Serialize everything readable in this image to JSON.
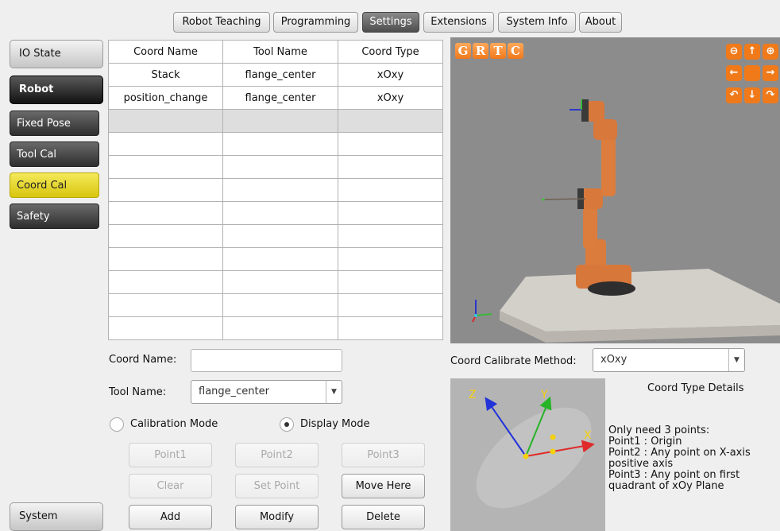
{
  "top_tabs": [
    "Robot Teaching",
    "Programming",
    "Settings",
    "Extensions",
    "System Info",
    "About"
  ],
  "active_tab": "Settings",
  "sidebar": {
    "io_state": "IO State",
    "robot": "Robot",
    "items": [
      "Fixed Pose",
      "Tool Cal",
      "Coord Cal",
      "Safety"
    ],
    "active_item": "Coord Cal",
    "system": "System"
  },
  "table": {
    "headers": [
      "Coord Name",
      "Tool Name",
      "Coord Type"
    ],
    "rows": [
      [
        "Stack",
        "flange_center",
        "xOxy"
      ],
      [
        "position_change",
        "flange_center",
        "xOxy"
      ]
    ]
  },
  "form": {
    "coord_name_label": "Coord Name:",
    "coord_name_value": "",
    "tool_name_label": "Tool Name:",
    "tool_name_value": "flange_center",
    "calibration_mode": "Calibration Mode",
    "display_mode": "Display Mode",
    "selected_mode": "Display Mode"
  },
  "buttons": {
    "point1": "Point1",
    "point2": "Point2",
    "point3": "Point3",
    "clear": "Clear",
    "set_point": "Set Point",
    "move_here": "Move Here",
    "add": "Add",
    "modify": "Modify",
    "delete": "Delete"
  },
  "view3d": {
    "grtc": [
      "G",
      "R",
      "T",
      "C"
    ]
  },
  "calibrate": {
    "method_label": "Coord Calibrate Method:",
    "method_value": "xOxy",
    "details_title": "Coord Type Details",
    "details_lines": [
      "Only need 3 points:",
      "Point1 : Origin",
      "Point2 : Any point on X-axis",
      "positive axis",
      "Point3 : Any point on first",
      "quadrant of xOy Plane"
    ],
    "axis_labels": {
      "z": "Z",
      "y": "Y",
      "x": "X"
    }
  },
  "colors": {
    "accent_orange": "#f07a1a",
    "active_yellow": "#e6d420",
    "view_bg": "#8c8c8c"
  }
}
